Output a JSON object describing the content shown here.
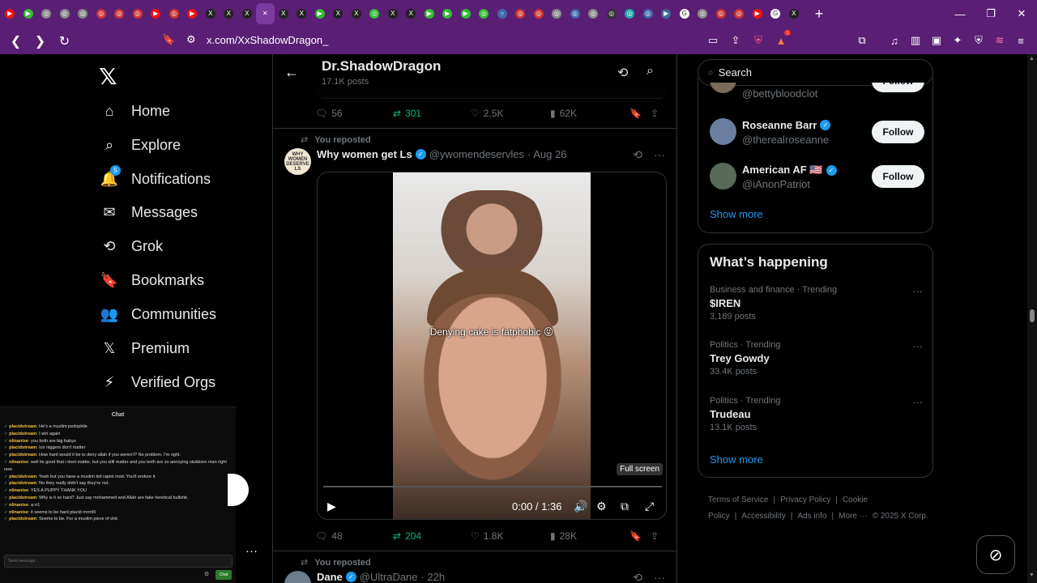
{
  "browser": {
    "url": "x.com/XxShadowDragon_",
    "tabs": [
      {
        "icon": "▶",
        "color": "#e11"
      },
      {
        "icon": "▶",
        "color": "#3b3"
      },
      {
        "icon": "◎",
        "color": "#888"
      },
      {
        "icon": "◎",
        "color": "#888"
      },
      {
        "icon": "◎",
        "color": "#888"
      },
      {
        "icon": "◎",
        "color": "#c33"
      },
      {
        "icon": "◎",
        "color": "#c33"
      },
      {
        "icon": "◎",
        "color": "#c33"
      },
      {
        "icon": "▶",
        "color": "#e11"
      },
      {
        "icon": "◎",
        "color": "#c33"
      },
      {
        "icon": "▶",
        "color": "#e11"
      },
      {
        "icon": "X",
        "color": "#222"
      },
      {
        "icon": "X",
        "color": "#222"
      },
      {
        "icon": "X",
        "color": "#222"
      },
      {
        "icon": "✕",
        "color": "transparent",
        "active": true
      },
      {
        "icon": "X",
        "color": "#222"
      },
      {
        "icon": "X",
        "color": "#222"
      },
      {
        "icon": "▶",
        "color": "#3b3"
      },
      {
        "icon": "X",
        "color": "#222"
      },
      {
        "icon": "X",
        "color": "#222"
      },
      {
        "icon": "◎",
        "color": "#3b3"
      },
      {
        "icon": "X",
        "color": "#222"
      },
      {
        "icon": "X",
        "color": "#222"
      },
      {
        "icon": "▶",
        "color": "#3b3"
      },
      {
        "icon": "▶",
        "color": "#3b3"
      },
      {
        "icon": "▶",
        "color": "#3b3"
      },
      {
        "icon": "◎",
        "color": "#3b3"
      },
      {
        "icon": "○",
        "color": "#46a"
      },
      {
        "icon": "◎",
        "color": "#c33"
      },
      {
        "icon": "◎",
        "color": "#c33"
      },
      {
        "icon": "◎",
        "color": "#888"
      },
      {
        "icon": "◎",
        "color": "#46a"
      },
      {
        "icon": "◎",
        "color": "#888"
      },
      {
        "icon": "◎",
        "color": "#333"
      },
      {
        "icon": "◎",
        "color": "#2aa"
      },
      {
        "icon": "◎",
        "color": "#46a"
      },
      {
        "icon": "▶",
        "color": "#469"
      },
      {
        "icon": "G",
        "color": "#fff"
      },
      {
        "icon": "◎",
        "color": "#888"
      },
      {
        "icon": "◎",
        "color": "#c33"
      },
      {
        "icon": "◎",
        "color": "#c33"
      },
      {
        "icon": "▶",
        "color": "#e11"
      },
      {
        "icon": "G",
        "color": "#fff"
      },
      {
        "icon": "X",
        "color": "#222"
      }
    ],
    "brave_badge": "1"
  },
  "nav": {
    "items": [
      {
        "label": "Home",
        "icon": "home-icon"
      },
      {
        "label": "Explore",
        "icon": "search-icon"
      },
      {
        "label": "Notifications",
        "icon": "bell-icon"
      },
      {
        "label": "Messages",
        "icon": "mail-icon"
      },
      {
        "label": "Grok",
        "icon": "grok-icon"
      },
      {
        "label": "Bookmarks",
        "icon": "bookmark-icon"
      },
      {
        "label": "Communities",
        "icon": "communities-icon"
      },
      {
        "label": "Premium",
        "icon": "x-icon"
      },
      {
        "label": "Verified Orgs",
        "icon": "lightning-icon"
      }
    ],
    "notifications_badge": "5"
  },
  "chat": {
    "title": "Chat",
    "placeholder": "Send message...",
    "send_label": "Chat",
    "messages": [
      {
        "user": "placidstream",
        "text": "He's a muslim pedophile"
      },
      {
        "user": "placidstream",
        "text": "I win again"
      },
      {
        "user": "nlinanise",
        "text": "you both are big babys"
      },
      {
        "user": "placidstream",
        "text": "Ice niggers don't matter"
      },
      {
        "user": "placidstream",
        "text": "How hard would it be to deny allah if you weren't? No problem. I'm right."
      },
      {
        "user": "nlinanise",
        "text": "well its good that i dont matter, but you still matter and you both are so annoying stubborn man right now"
      },
      {
        "user": "placidstream",
        "text": "Yeah but you have a muslim kid rapist mod. You'll endure it"
      },
      {
        "user": "placidstream",
        "text": "No they really didn't say they're not."
      },
      {
        "user": "nlinanise",
        "text": "YES A PUPPY THANK YOU"
      },
      {
        "user": "placidstream",
        "text": "Why is it so hard? Just say mohammed and Allah are fake heretical bullshit."
      },
      {
        "user": "nlinanise",
        "text": "a:rr1"
      },
      {
        "user": "nlinanise",
        "text": "it seems to be hard placid mrrrrlll"
      },
      {
        "user": "placidstream",
        "text": "Seems to be. For a muslim piece of shit."
      }
    ]
  },
  "profile": {
    "name": "Dr.ShadowDragon",
    "posts": "17.1K posts"
  },
  "prev_tweet": {
    "replies": "56",
    "reposts": "301",
    "likes": "2.5K",
    "views": "62K"
  },
  "tweet1": {
    "repost_label": "You reposted",
    "author": "Why women get Ls",
    "avatar_text": "WHY WOMEN DESERVE LS",
    "handle": "@ywomendeservles",
    "date": "· Aug 26",
    "caption": "Denying cake is fatphobic 😝",
    "fullscreen_tip": "Full screen",
    "time": "0:00 / 1:36",
    "progress_fraction": 0,
    "replies": "48",
    "reposts": "204",
    "likes": "1.8K",
    "views": "28K"
  },
  "tweet2": {
    "repost_label": "You reposted",
    "author": "Dane",
    "handle": "@UltraDane",
    "date": "· 22h"
  },
  "search": {
    "placeholder": "Search"
  },
  "who_to_follow": {
    "partial_handle": "@bettybloodclot",
    "users": [
      {
        "name": "Roseanne Barr",
        "handle": "@therealroseanne",
        "follow": "Follow"
      },
      {
        "name": "American AF 🇺🇸",
        "handle": "@iAnonPatriot",
        "follow": "Follow"
      }
    ],
    "show_more": "Show more"
  },
  "trends": {
    "title": "What’s happening",
    "items": [
      {
        "meta": "Business and finance · Trending",
        "title": "$IREN",
        "count": "3,189 posts"
      },
      {
        "meta": "Politics · Trending",
        "title": "Trey Gowdy",
        "count": "33.4K posts"
      },
      {
        "meta": "Politics · Trending",
        "title": "Trudeau",
        "count": "13.1K posts"
      }
    ],
    "show_more": "Show more"
  },
  "footer": {
    "links": [
      "Terms of Service",
      "|",
      "Privacy Policy",
      "|",
      "Cookie Policy",
      "|",
      "Accessibility",
      "|",
      "Ads info",
      "|",
      "More ···",
      "© 2025 X Corp."
    ]
  },
  "colors": {
    "accent": "#1d9bf0",
    "repost_green": "#00ba7c",
    "browser_purple": "#5a1e74"
  }
}
